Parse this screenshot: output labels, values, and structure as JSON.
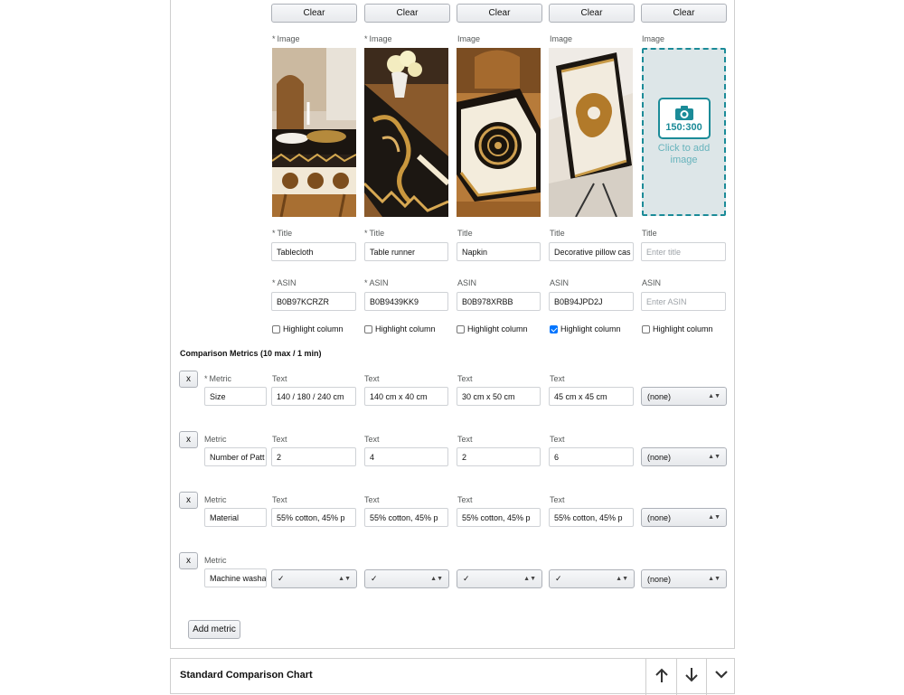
{
  "clear_label": "Clear",
  "columns": [
    {
      "image_label": "Image",
      "image_required": true,
      "title_label": "Title",
      "title_required": true,
      "title_value": "Tablecloth",
      "asin_label": "ASIN",
      "asin_required": true,
      "asin_value": "B0B97KCRZR",
      "highlight_label": "Highlight column",
      "highlighted": false
    },
    {
      "image_label": "Image",
      "image_required": true,
      "title_label": "Title",
      "title_required": true,
      "title_value": "Table runner",
      "asin_label": "ASIN",
      "asin_required": true,
      "asin_value": "B0B9439KK9",
      "highlight_label": "Highlight column",
      "highlighted": false
    },
    {
      "image_label": "Image",
      "image_required": false,
      "title_label": "Title",
      "title_required": false,
      "title_value": "Napkin",
      "asin_label": "ASIN",
      "asin_required": false,
      "asin_value": "B0B978XRBB",
      "highlight_label": "Highlight column",
      "highlighted": false
    },
    {
      "image_label": "Image",
      "image_required": false,
      "title_label": "Title",
      "title_required": false,
      "title_value": "Decorative pillow cas",
      "asin_label": "ASIN",
      "asin_required": false,
      "asin_value": "B0B94JPD2J",
      "highlight_label": "Highlight column",
      "highlighted": true
    },
    {
      "image_label": "Image",
      "image_required": false,
      "title_label": "Title",
      "title_required": false,
      "title_placeholder": "Enter title",
      "asin_label": "ASIN",
      "asin_required": false,
      "asin_placeholder": "Enter ASIN",
      "highlight_label": "Highlight column",
      "highlighted": false
    }
  ],
  "upload": {
    "ratio": "150:300",
    "text": "Click to add image",
    "icon": "camera-icon"
  },
  "metrics_heading": "Comparison Metrics (10 max / 1 min)",
  "remove_label": "x",
  "metric_label": "Metric",
  "text_label": "Text",
  "none_option": "(none)",
  "metrics": [
    {
      "required": true,
      "name": "Size",
      "type": "text",
      "values": [
        "140 / 180 / 240 cm",
        "140 cm x 40 cm",
        "30 cm x 50 cm",
        "45 cm x 45 cm"
      ]
    },
    {
      "required": false,
      "name": "Number of Patt",
      "type": "text",
      "values": [
        "2",
        "4",
        "2",
        "6"
      ]
    },
    {
      "required": false,
      "name": "Material",
      "type": "text",
      "values": [
        "55% cotton, 45% p",
        "55% cotton, 45% p",
        "55% cotton, 45% p",
        "55% cotton, 45% p"
      ]
    },
    {
      "required": false,
      "name": "Machine washa",
      "type": "select",
      "values": [
        "✓",
        "✓",
        "✓",
        "✓"
      ]
    }
  ],
  "add_metric_label": "Add metric",
  "next_section_title": "Standard Comparison Chart",
  "section_controls": [
    "arrow-up-icon",
    "arrow-down-icon",
    "chevron-down-icon"
  ],
  "colors": {
    "upload_border": "#1b8b98",
    "upload_bg": "#dde6e8",
    "checkbox_on": "#0075ff"
  }
}
